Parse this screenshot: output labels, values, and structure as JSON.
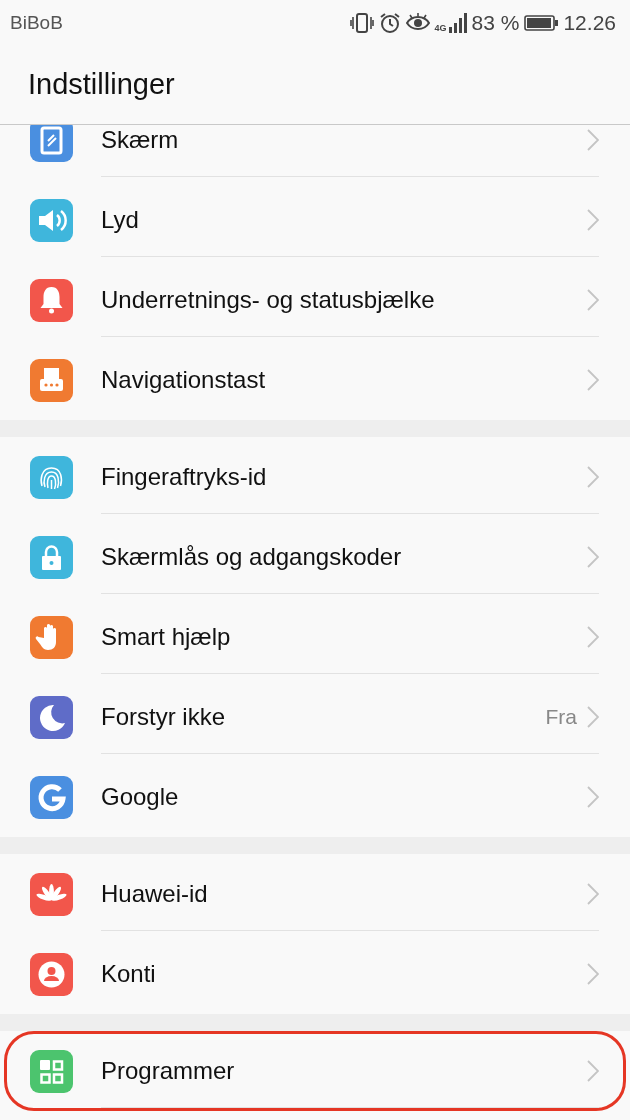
{
  "status_bar": {
    "carrier": "BiBoB",
    "network": "4G",
    "battery_percent": "83 %",
    "time": "12.26"
  },
  "header": {
    "title": "Indstillinger"
  },
  "groups": [
    {
      "items": [
        {
          "kind": "display",
          "label": "Skærm",
          "highlighted": false
        },
        {
          "kind": "sound",
          "label": "Lyd",
          "highlighted": false
        },
        {
          "kind": "bell",
          "label": "Underretnings- og statusbjælke",
          "highlighted": false
        },
        {
          "kind": "navkey",
          "label": "Navigationstast",
          "highlighted": false
        }
      ]
    },
    {
      "items": [
        {
          "kind": "fingerprint",
          "label": "Fingeraftryks-id",
          "highlighted": false
        },
        {
          "kind": "lock",
          "label": "Skærmlås og adgangskoder",
          "highlighted": false
        },
        {
          "kind": "hand",
          "label": "Smart hjælp",
          "highlighted": false
        },
        {
          "kind": "moon",
          "label": "Forstyr ikke",
          "value": "Fra",
          "highlighted": false
        },
        {
          "kind": "google",
          "label": "Google",
          "highlighted": false
        }
      ]
    },
    {
      "items": [
        {
          "kind": "flower",
          "label": "Huawei-id",
          "highlighted": false
        },
        {
          "kind": "person",
          "label": "Konti",
          "highlighted": false
        }
      ]
    },
    {
      "items": [
        {
          "kind": "apps",
          "label": "Programmer",
          "highlighted": true
        }
      ]
    }
  ]
}
